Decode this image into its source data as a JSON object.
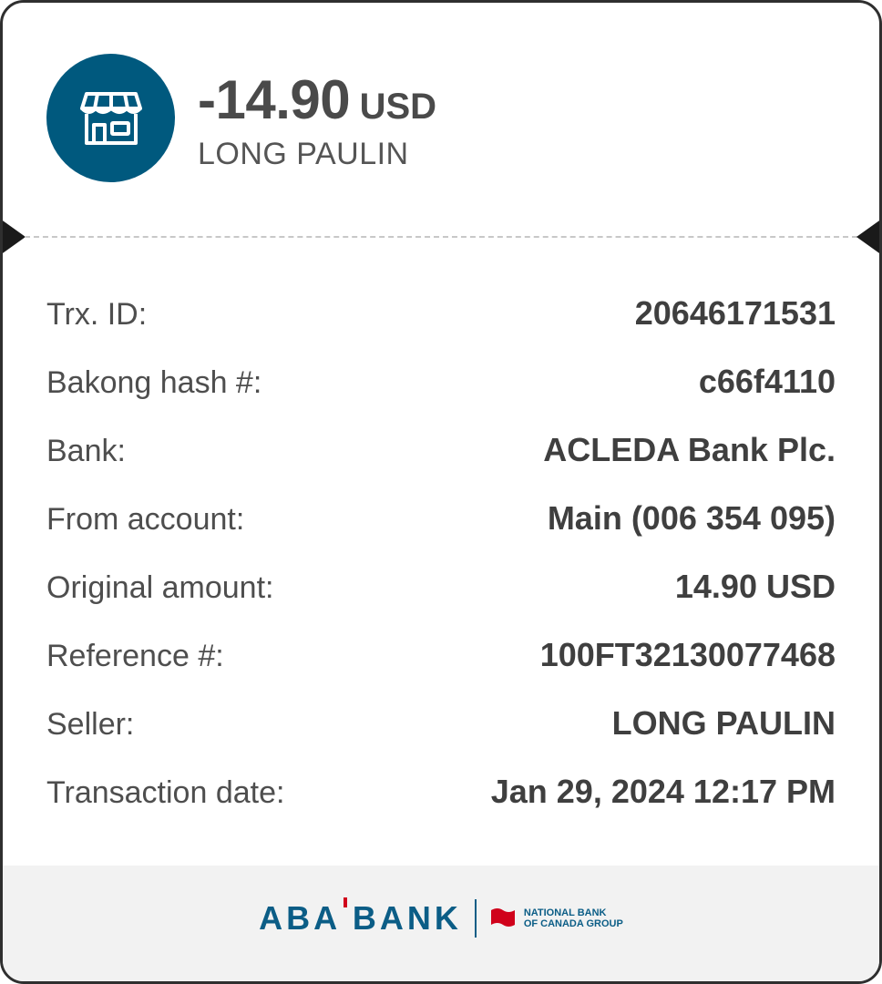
{
  "transaction": {
    "amount": "-14.90",
    "currency": "USD",
    "merchant": "LONG PAULIN"
  },
  "details": [
    {
      "label": "Trx. ID:",
      "value": "20646171531"
    },
    {
      "label": "Bakong hash #:",
      "value": "c66f4110"
    },
    {
      "label": "Bank:",
      "value": "ACLEDA Bank Plc."
    },
    {
      "label": "From account:",
      "value": "Main (006 354 095)"
    },
    {
      "label": "Original amount:",
      "value": "14.90 USD"
    },
    {
      "label": "Reference #:",
      "value": "100FT32130077468"
    },
    {
      "label": "Seller:",
      "value": "LONG PAULIN"
    },
    {
      "label": "Transaction date:",
      "value": "Jan 29, 2024 12:17 PM"
    }
  ],
  "footer": {
    "bank_logo_text": "ABA BANK",
    "group_line1": "NATIONAL BANK",
    "group_line2": "OF CANADA GROUP"
  },
  "icons": {
    "merchant": "storefront-icon",
    "group_flag": "red-flag-icon"
  },
  "colors": {
    "brand_blue": "#00597e",
    "logo_blue": "#0b5d86",
    "accent_red": "#d0021b"
  }
}
